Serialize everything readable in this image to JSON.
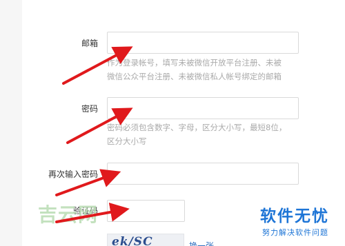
{
  "form": {
    "email": {
      "label": "邮箱",
      "value": "",
      "hint_line1": "作为登录帐号，填写未被微信开放平台注册、未被",
      "hint_line2": "微信公众平台注册、未被微信私人帐号绑定的邮箱"
    },
    "password": {
      "label": "密码",
      "value": "",
      "hint_line1": "密码必须包含数字、字母，区分大小写，最短8位，",
      "hint_line2": "区分大小写"
    },
    "confirm_password": {
      "label": "再次输入密码",
      "value": ""
    },
    "captcha": {
      "label": "验证码",
      "value": "",
      "image_text": "ek/SC",
      "refresh_label": "换一张"
    }
  },
  "watermarks": {
    "left": "吉云网",
    "right_main": "软件无忧",
    "right_sub": "努力解决软件问题"
  },
  "colors": {
    "arrow": "#e0191c",
    "watermark_blue": "#1e75d6",
    "watermark_green": "#b9dcb3"
  }
}
